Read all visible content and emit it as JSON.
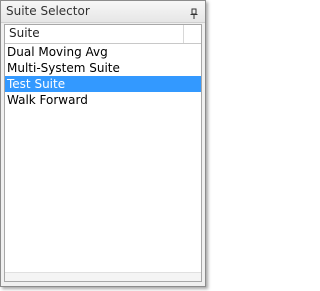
{
  "panel": {
    "title": "Suite Selector",
    "pin_icon": "pin-icon"
  },
  "list": {
    "column_header": "Suite",
    "items": [
      {
        "label": "Dual Moving Avg",
        "selected": false
      },
      {
        "label": "Multi-System Suite",
        "selected": false
      },
      {
        "label": "Test Suite",
        "selected": true
      },
      {
        "label": "Walk Forward",
        "selected": false
      }
    ]
  },
  "colors": {
    "selection": "#3399ff"
  }
}
